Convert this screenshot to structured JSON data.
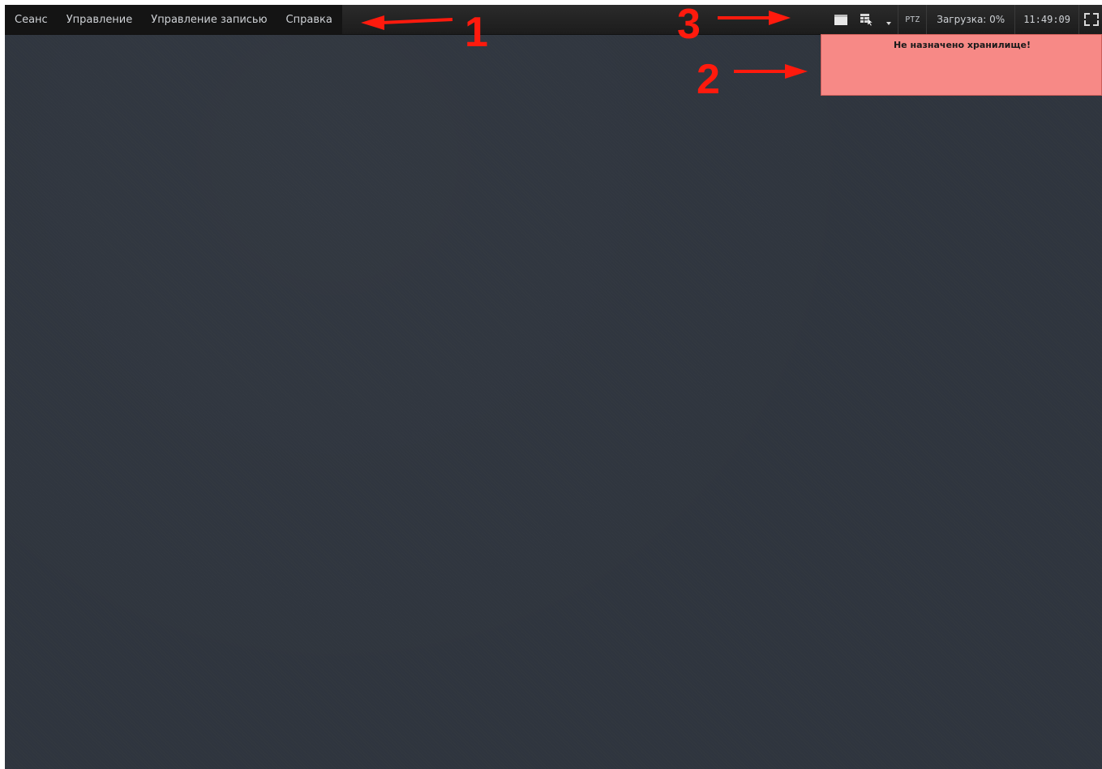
{
  "menu": {
    "items": [
      "Сеанс",
      "Управление",
      "Управление записью",
      "Справка"
    ]
  },
  "toolbar": {
    "single_view_icon": "single-window-icon",
    "multi_view_icon": "grid-layout-icon",
    "dropdown_icon": "chevron-down-icon",
    "ptz_label": "PTZ",
    "load_text": "Загрузка: 0%",
    "clock": "11:49:09",
    "fullscreen_icon": "fullscreen-icon"
  },
  "notification": {
    "text": "Не назначено хранилище!",
    "color": "#f78986"
  },
  "annotations": {
    "label_1": "1",
    "label_2": "2",
    "label_3": "3",
    "color": "#ff1a0d"
  }
}
